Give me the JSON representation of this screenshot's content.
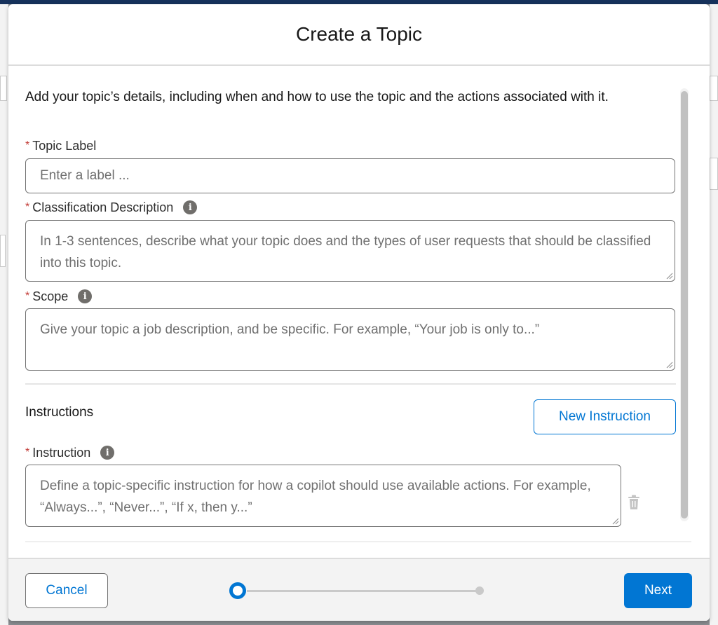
{
  "modal": {
    "title": "Create a Topic",
    "intro": "Add your topic’s details, including when and how to use the topic and the actions associated with it."
  },
  "fields": {
    "topic_label": {
      "label": "Topic Label",
      "required_marker": "*",
      "placeholder": "Enter a label ..."
    },
    "classification_description": {
      "label": "Classification Description",
      "required_marker": "*",
      "placeholder": "In 1-3 sentences, describe what your topic does and the types of user requests that should be classified into this topic."
    },
    "scope": {
      "label": "Scope",
      "required_marker": "*",
      "placeholder": "Give your topic a job description, and be specific. For example, “Your job is only to...”"
    }
  },
  "instructions": {
    "section_title": "Instructions",
    "new_button_label": "New Instruction",
    "instruction": {
      "label": "Instruction",
      "required_marker": "*",
      "placeholder": "Define a topic-specific instruction for how a copilot should use available actions. For example, “Always...”, “Never...”, “If x, then y...”"
    }
  },
  "footer": {
    "cancel_label": "Cancel",
    "next_label": "Next",
    "progress": {
      "current_step": 1,
      "total_steps": 2
    }
  },
  "colors": {
    "brand": "#0176d3",
    "required": "#c23934",
    "info_icon": "#706e6b"
  },
  "icons": {
    "info": "info-icon",
    "delete": "trash-icon"
  }
}
